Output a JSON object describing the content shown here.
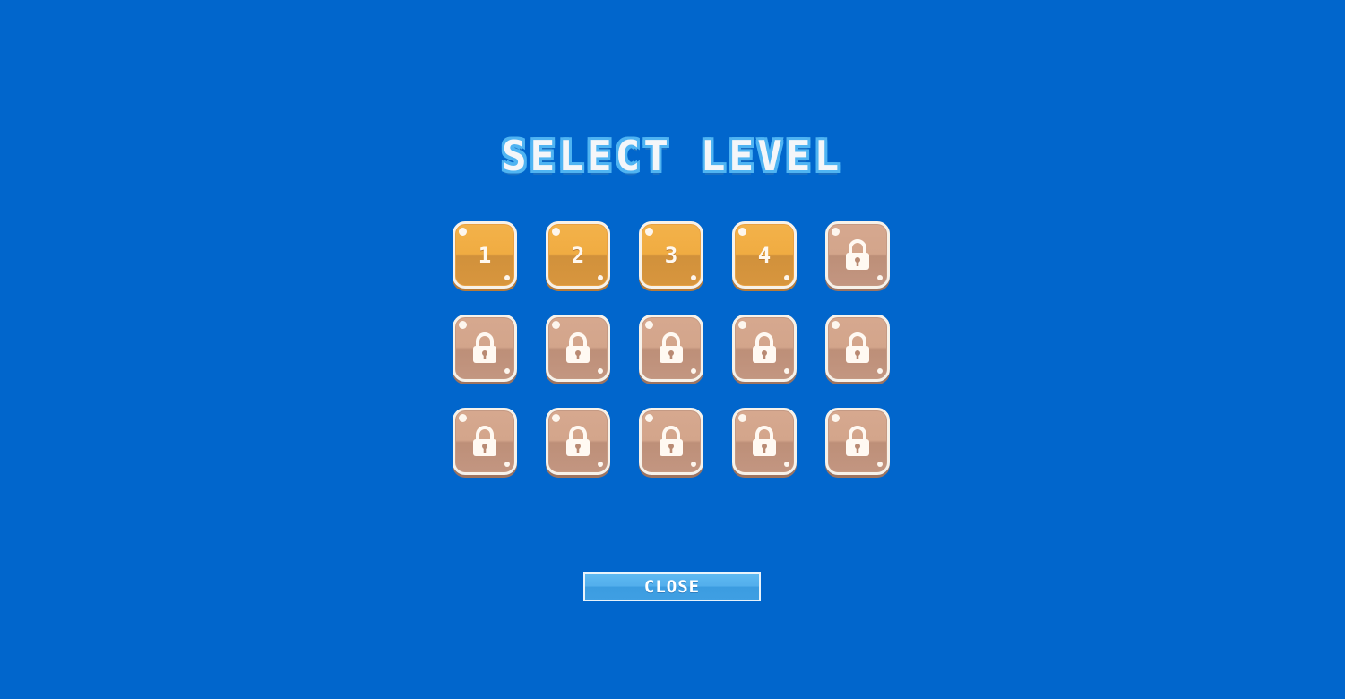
{
  "screen": {
    "title": "SELECT LEVEL",
    "background_color": "#0166cc"
  },
  "levels": [
    {
      "label": "1",
      "locked": false
    },
    {
      "label": "2",
      "locked": false
    },
    {
      "label": "3",
      "locked": false
    },
    {
      "label": "4",
      "locked": false
    },
    {
      "label": "",
      "locked": true,
      "icon": "lock-icon"
    },
    {
      "label": "",
      "locked": true,
      "icon": "lock-icon"
    },
    {
      "label": "",
      "locked": true,
      "icon": "lock-icon"
    },
    {
      "label": "",
      "locked": true,
      "icon": "lock-icon"
    },
    {
      "label": "",
      "locked": true,
      "icon": "lock-icon"
    },
    {
      "label": "",
      "locked": true,
      "icon": "lock-icon"
    },
    {
      "label": "",
      "locked": true,
      "icon": "lock-icon"
    },
    {
      "label": "",
      "locked": true,
      "icon": "lock-icon"
    },
    {
      "label": "",
      "locked": true,
      "icon": "lock-icon"
    },
    {
      "label": "",
      "locked": true,
      "icon": "lock-icon"
    },
    {
      "label": "",
      "locked": true,
      "icon": "lock-icon"
    }
  ],
  "colors": {
    "unlocked_tile": "#f0ac42",
    "locked_tile": "#d3a58b",
    "close_button": "#52aeec"
  },
  "close_button": {
    "label": "CLOSE"
  }
}
